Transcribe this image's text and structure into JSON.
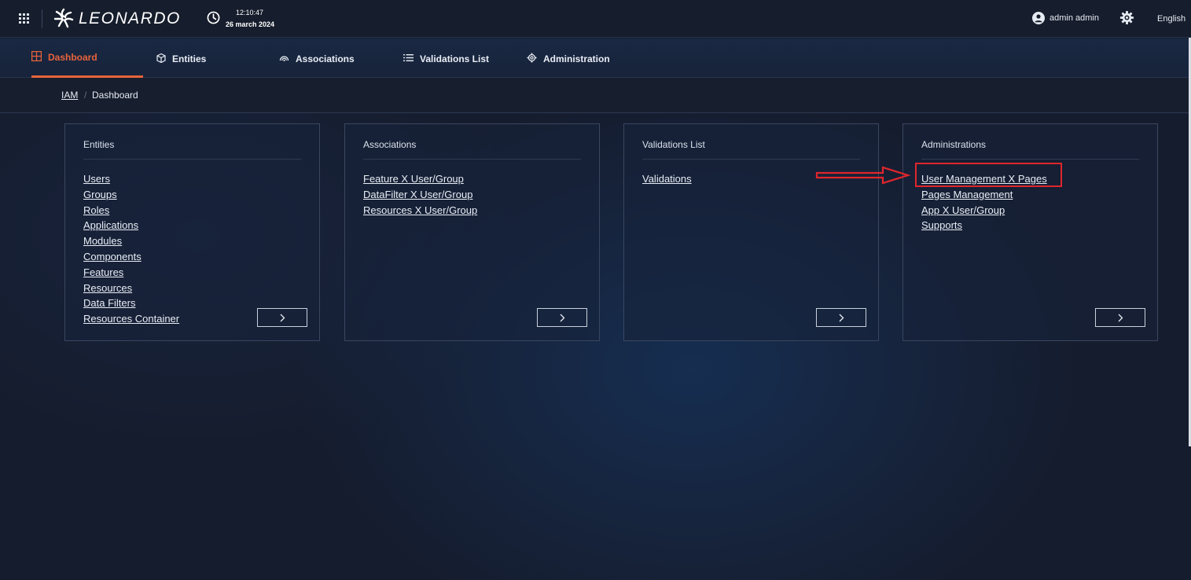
{
  "header": {
    "brand": "LEONARDO",
    "time": "12:10:47",
    "date": "26 march 2024",
    "user": "admin admin",
    "language": "English"
  },
  "nav": {
    "tabs": [
      {
        "label": "Dashboard",
        "icon": "dashboard-icon",
        "active": true
      },
      {
        "label": "Entities",
        "icon": "entities-icon",
        "active": false
      },
      {
        "label": "Associations",
        "icon": "associations-icon",
        "active": false
      },
      {
        "label": "Validations List",
        "icon": "list-icon",
        "active": false
      },
      {
        "label": "Administration",
        "icon": "gear-icon",
        "active": false
      }
    ]
  },
  "breadcrumb": {
    "root": "IAM",
    "separator": "/",
    "current": "Dashboard"
  },
  "cards": [
    {
      "title": "Entities",
      "links": [
        "Users",
        "Groups",
        "Roles",
        "Applications",
        "Modules",
        "Components",
        "Features",
        "Resources",
        "Data Filters",
        "Resources Container"
      ]
    },
    {
      "title": "Associations",
      "links": [
        "Feature X User/Group",
        "DataFilter X User/Group",
        "Resources X User/Group"
      ]
    },
    {
      "title": "Validations List",
      "links": [
        "Validations"
      ]
    },
    {
      "title": "Administrations",
      "links": [
        "User Management X Pages",
        "Pages Management",
        "App X User/Group",
        "Supports"
      ]
    }
  ],
  "colors": {
    "accent": "#e8643c",
    "background": "#151c2d",
    "annotation": "#e0262c"
  },
  "annotation": {
    "target": "User Management X Pages"
  }
}
